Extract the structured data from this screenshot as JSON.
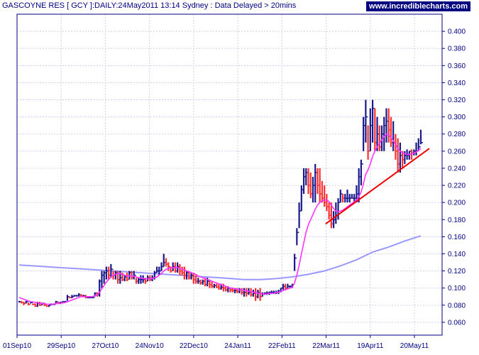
{
  "header": {
    "title": "GASCOYNE RES [ GCY ]:DAILY:24May2011 13:14 Sydney : Data Delayed > 20mins",
    "brand": "www.incrediblecharts.com"
  },
  "colors": {
    "grid": "#d0d0e8",
    "frame": "#000080",
    "bar_up": "#1a1a8c",
    "bar_down": "#ff3030",
    "ma_short": "#ff33ff",
    "ma_long": "#9999ff",
    "trendline": "#ee0000"
  },
  "chart_data": {
    "type": "line",
    "title": "GASCOYNE RES [ GCY ]:DAILY:24May2011 13:14 Sydney : Data Delayed > 20mins",
    "xlabel": "",
    "ylabel": "",
    "x_ticks": [
      "01Sep10",
      "29Sep10",
      "27Oct10",
      "24Nov10",
      "22Dec10",
      "24Jan11",
      "22Feb11",
      "22Mar11",
      "19Apr11",
      "20May11"
    ],
    "y_ticks": [
      0.06,
      0.08,
      0.1,
      0.12,
      0.14,
      0.16,
      0.18,
      0.2,
      0.22,
      0.24,
      0.26,
      0.28,
      0.3,
      0.32,
      0.34,
      0.36,
      0.38,
      0.4
    ],
    "ylim": [
      0.045,
      0.42
    ],
    "grid": true,
    "axis_side": "right",
    "price_bars": {
      "highs": [
        0.085,
        0.085,
        0.084,
        0.085,
        0.083,
        0.084,
        0.082,
        0.082,
        0.084,
        0.084,
        0.083,
        0.083,
        0.08,
        0.08,
        0.082,
        0.082,
        0.085,
        0.084,
        0.084,
        0.085,
        0.085,
        0.092,
        0.09,
        0.092,
        0.092,
        0.092,
        0.094,
        0.093,
        0.092,
        0.092,
        0.09,
        0.09,
        0.09,
        0.095,
        0.095,
        0.11,
        0.12,
        0.12,
        0.125,
        0.125,
        0.128,
        0.12,
        0.12,
        0.12,
        0.12,
        0.118,
        0.115,
        0.118,
        0.12,
        0.12,
        0.12,
        0.112,
        0.112,
        0.115,
        0.115,
        0.112,
        0.115,
        0.115,
        0.115,
        0.12,
        0.125,
        0.125,
        0.13,
        0.14,
        0.135,
        0.13,
        0.125,
        0.13,
        0.13,
        0.13,
        0.128,
        0.125,
        0.125,
        0.12,
        0.12,
        0.118,
        0.118,
        0.115,
        0.112,
        0.11,
        0.11,
        0.112,
        0.112,
        0.11,
        0.108,
        0.105,
        0.105,
        0.105,
        0.105,
        0.105,
        0.102,
        0.102,
        0.1,
        0.1,
        0.1,
        0.1,
        0.1,
        0.1,
        0.1,
        0.1,
        0.1,
        0.1,
        0.098,
        0.1,
        0.098,
        0.1,
        0.095,
        0.095,
        0.096,
        0.096,
        0.097,
        0.097,
        0.097,
        0.098,
        0.1,
        0.105,
        0.105,
        0.105,
        0.103,
        0.105,
        0.14,
        0.17,
        0.2,
        0.22,
        0.24,
        0.24,
        0.24,
        0.235,
        0.23,
        0.245,
        0.24,
        0.24,
        0.225,
        0.22,
        0.21,
        0.2,
        0.2,
        0.19,
        0.2,
        0.205,
        0.215,
        0.21,
        0.21,
        0.215,
        0.21,
        0.21,
        0.21,
        0.22,
        0.24,
        0.25,
        0.3,
        0.32,
        0.29,
        0.31,
        0.32,
        0.31,
        0.3,
        0.29,
        0.29,
        0.3,
        0.31,
        0.31,
        0.3,
        0.295,
        0.28,
        0.275,
        0.27,
        0.26,
        0.26,
        0.262,
        0.26,
        0.262,
        0.262,
        0.27,
        0.275,
        0.285
      ],
      "lows": [
        0.083,
        0.082,
        0.08,
        0.082,
        0.08,
        0.082,
        0.08,
        0.078,
        0.078,
        0.079,
        0.08,
        0.079,
        0.078,
        0.078,
        0.08,
        0.08,
        0.082,
        0.082,
        0.082,
        0.082,
        0.083,
        0.085,
        0.088,
        0.088,
        0.09,
        0.09,
        0.09,
        0.09,
        0.09,
        0.088,
        0.088,
        0.088,
        0.088,
        0.09,
        0.09,
        0.09,
        0.1,
        0.105,
        0.11,
        0.11,
        0.112,
        0.11,
        0.11,
        0.105,
        0.105,
        0.108,
        0.108,
        0.108,
        0.11,
        0.11,
        0.11,
        0.105,
        0.105,
        0.105,
        0.106,
        0.105,
        0.108,
        0.108,
        0.108,
        0.11,
        0.118,
        0.115,
        0.12,
        0.125,
        0.125,
        0.12,
        0.118,
        0.12,
        0.118,
        0.118,
        0.115,
        0.115,
        0.11,
        0.11,
        0.11,
        0.11,
        0.105,
        0.105,
        0.105,
        0.104,
        0.104,
        0.102,
        0.102,
        0.1,
        0.1,
        0.1,
        0.1,
        0.098,
        0.098,
        0.096,
        0.096,
        0.095,
        0.095,
        0.095,
        0.094,
        0.094,
        0.094,
        0.092,
        0.09,
        0.09,
        0.092,
        0.09,
        0.09,
        0.085,
        0.088,
        0.085,
        0.09,
        0.092,
        0.092,
        0.092,
        0.093,
        0.093,
        0.093,
        0.093,
        0.095,
        0.098,
        0.098,
        0.1,
        0.1,
        0.1,
        0.12,
        0.15,
        0.17,
        0.19,
        0.21,
        0.22,
        0.21,
        0.205,
        0.2,
        0.2,
        0.21,
        0.2,
        0.2,
        0.195,
        0.19,
        0.18,
        0.17,
        0.17,
        0.175,
        0.18,
        0.2,
        0.2,
        0.2,
        0.2,
        0.2,
        0.205,
        0.2,
        0.2,
        0.2,
        0.22,
        0.26,
        0.27,
        0.25,
        0.26,
        0.27,
        0.26,
        0.26,
        0.26,
        0.26,
        0.26,
        0.27,
        0.27,
        0.265,
        0.26,
        0.25,
        0.235,
        0.235,
        0.24,
        0.245,
        0.25,
        0.25,
        0.25,
        0.255,
        0.255,
        0.26,
        0.268
      ],
      "closes": [
        0.084,
        0.083,
        0.082,
        0.084,
        0.081,
        0.083,
        0.081,
        0.079,
        0.082,
        0.08,
        0.082,
        0.08,
        0.079,
        0.08,
        0.081,
        0.081,
        0.084,
        0.083,
        0.083,
        0.084,
        0.084,
        0.09,
        0.089,
        0.09,
        0.091,
        0.091,
        0.092,
        0.091,
        0.091,
        0.089,
        0.089,
        0.089,
        0.089,
        0.094,
        0.092,
        0.108,
        0.115,
        0.118,
        0.12,
        0.115,
        0.122,
        0.115,
        0.118,
        0.11,
        0.112,
        0.11,
        0.113,
        0.11,
        0.118,
        0.112,
        0.115,
        0.108,
        0.11,
        0.11,
        0.11,
        0.108,
        0.112,
        0.11,
        0.112,
        0.118,
        0.12,
        0.12,
        0.125,
        0.13,
        0.128,
        0.125,
        0.12,
        0.125,
        0.12,
        0.125,
        0.12,
        0.118,
        0.115,
        0.118,
        0.112,
        0.115,
        0.11,
        0.108,
        0.108,
        0.106,
        0.108,
        0.104,
        0.108,
        0.104,
        0.102,
        0.103,
        0.101,
        0.1,
        0.101,
        0.1,
        0.098,
        0.1,
        0.098,
        0.097,
        0.097,
        0.096,
        0.098,
        0.095,
        0.095,
        0.094,
        0.095,
        0.092,
        0.094,
        0.09,
        0.095,
        0.09,
        0.093,
        0.094,
        0.094,
        0.095,
        0.095,
        0.095,
        0.095,
        0.096,
        0.1,
        0.102,
        0.1,
        0.102,
        0.102,
        0.104,
        0.135,
        0.165,
        0.19,
        0.215,
        0.23,
        0.235,
        0.22,
        0.21,
        0.22,
        0.235,
        0.22,
        0.21,
        0.205,
        0.2,
        0.195,
        0.185,
        0.175,
        0.18,
        0.185,
        0.2,
        0.21,
        0.205,
        0.205,
        0.205,
        0.205,
        0.205,
        0.205,
        0.21,
        0.23,
        0.245,
        0.29,
        0.3,
        0.26,
        0.29,
        0.31,
        0.27,
        0.28,
        0.265,
        0.28,
        0.29,
        0.295,
        0.285,
        0.27,
        0.27,
        0.26,
        0.245,
        0.255,
        0.25,
        0.255,
        0.255,
        0.26,
        0.258,
        0.26,
        0.26,
        0.265,
        0.27
      ]
    },
    "series": [
      {
        "kind": "moving_average_short",
        "values": [
          0.089,
          0.088,
          0.087,
          0.086,
          0.085,
          0.084,
          0.084,
          0.083,
          0.083,
          0.082,
          0.082,
          0.082,
          0.081,
          0.081,
          0.081,
          0.081,
          0.082,
          0.082,
          0.082,
          0.083,
          0.083,
          0.084,
          0.085,
          0.086,
          0.087,
          0.088,
          0.089,
          0.09,
          0.09,
          0.09,
          0.09,
          0.09,
          0.09,
          0.091,
          0.092,
          0.095,
          0.099,
          0.103,
          0.107,
          0.11,
          0.113,
          0.115,
          0.116,
          0.117,
          0.117,
          0.116,
          0.115,
          0.114,
          0.114,
          0.114,
          0.114,
          0.113,
          0.112,
          0.112,
          0.111,
          0.111,
          0.111,
          0.111,
          0.111,
          0.112,
          0.113,
          0.115,
          0.117,
          0.12,
          0.122,
          0.123,
          0.124,
          0.124,
          0.124,
          0.124,
          0.123,
          0.122,
          0.121,
          0.12,
          0.119,
          0.118,
          0.117,
          0.116,
          0.114,
          0.113,
          0.112,
          0.111,
          0.11,
          0.109,
          0.108,
          0.107,
          0.106,
          0.105,
          0.104,
          0.103,
          0.102,
          0.101,
          0.1,
          0.1,
          0.099,
          0.099,
          0.098,
          0.098,
          0.097,
          0.097,
          0.096,
          0.096,
          0.095,
          0.095,
          0.094,
          0.094,
          0.093,
          0.093,
          0.093,
          0.094,
          0.094,
          0.094,
          0.095,
          0.095,
          0.096,
          0.097,
          0.098,
          0.099,
          0.1,
          0.101,
          0.106,
          0.115,
          0.127,
          0.14,
          0.153,
          0.165,
          0.174,
          0.18,
          0.186,
          0.192,
          0.197,
          0.2,
          0.202,
          0.203,
          0.203,
          0.201,
          0.197,
          0.193,
          0.19,
          0.189,
          0.19,
          0.191,
          0.193,
          0.195,
          0.197,
          0.199,
          0.201,
          0.203,
          0.207,
          0.212,
          0.222,
          0.233,
          0.238,
          0.245,
          0.254,
          0.26,
          0.265,
          0.269,
          0.273,
          0.277,
          0.28,
          0.279,
          0.276,
          0.272,
          0.268,
          0.263,
          0.26,
          0.258,
          0.257,
          0.256,
          0.256,
          0.257,
          0.258,
          0.259,
          0.261,
          0.263
        ]
      },
      {
        "kind": "moving_average_long",
        "values": [
          0.127,
          0.1258,
          0.1246,
          0.1234,
          0.1222,
          0.121,
          0.1198,
          0.1186,
          0.1174,
          0.1162,
          0.115,
          0.1138,
          0.1126,
          0.1114,
          0.11,
          0.11,
          0.111,
          0.113,
          0.116,
          0.12,
          0.126,
          0.133,
          0.142,
          0.148,
          0.155,
          0.161
        ]
      }
    ],
    "trendline": {
      "from": {
        "x": "18Mar11",
        "y": 0.175
      },
      "to": {
        "x": "24May11",
        "y": 0.263
      }
    }
  }
}
